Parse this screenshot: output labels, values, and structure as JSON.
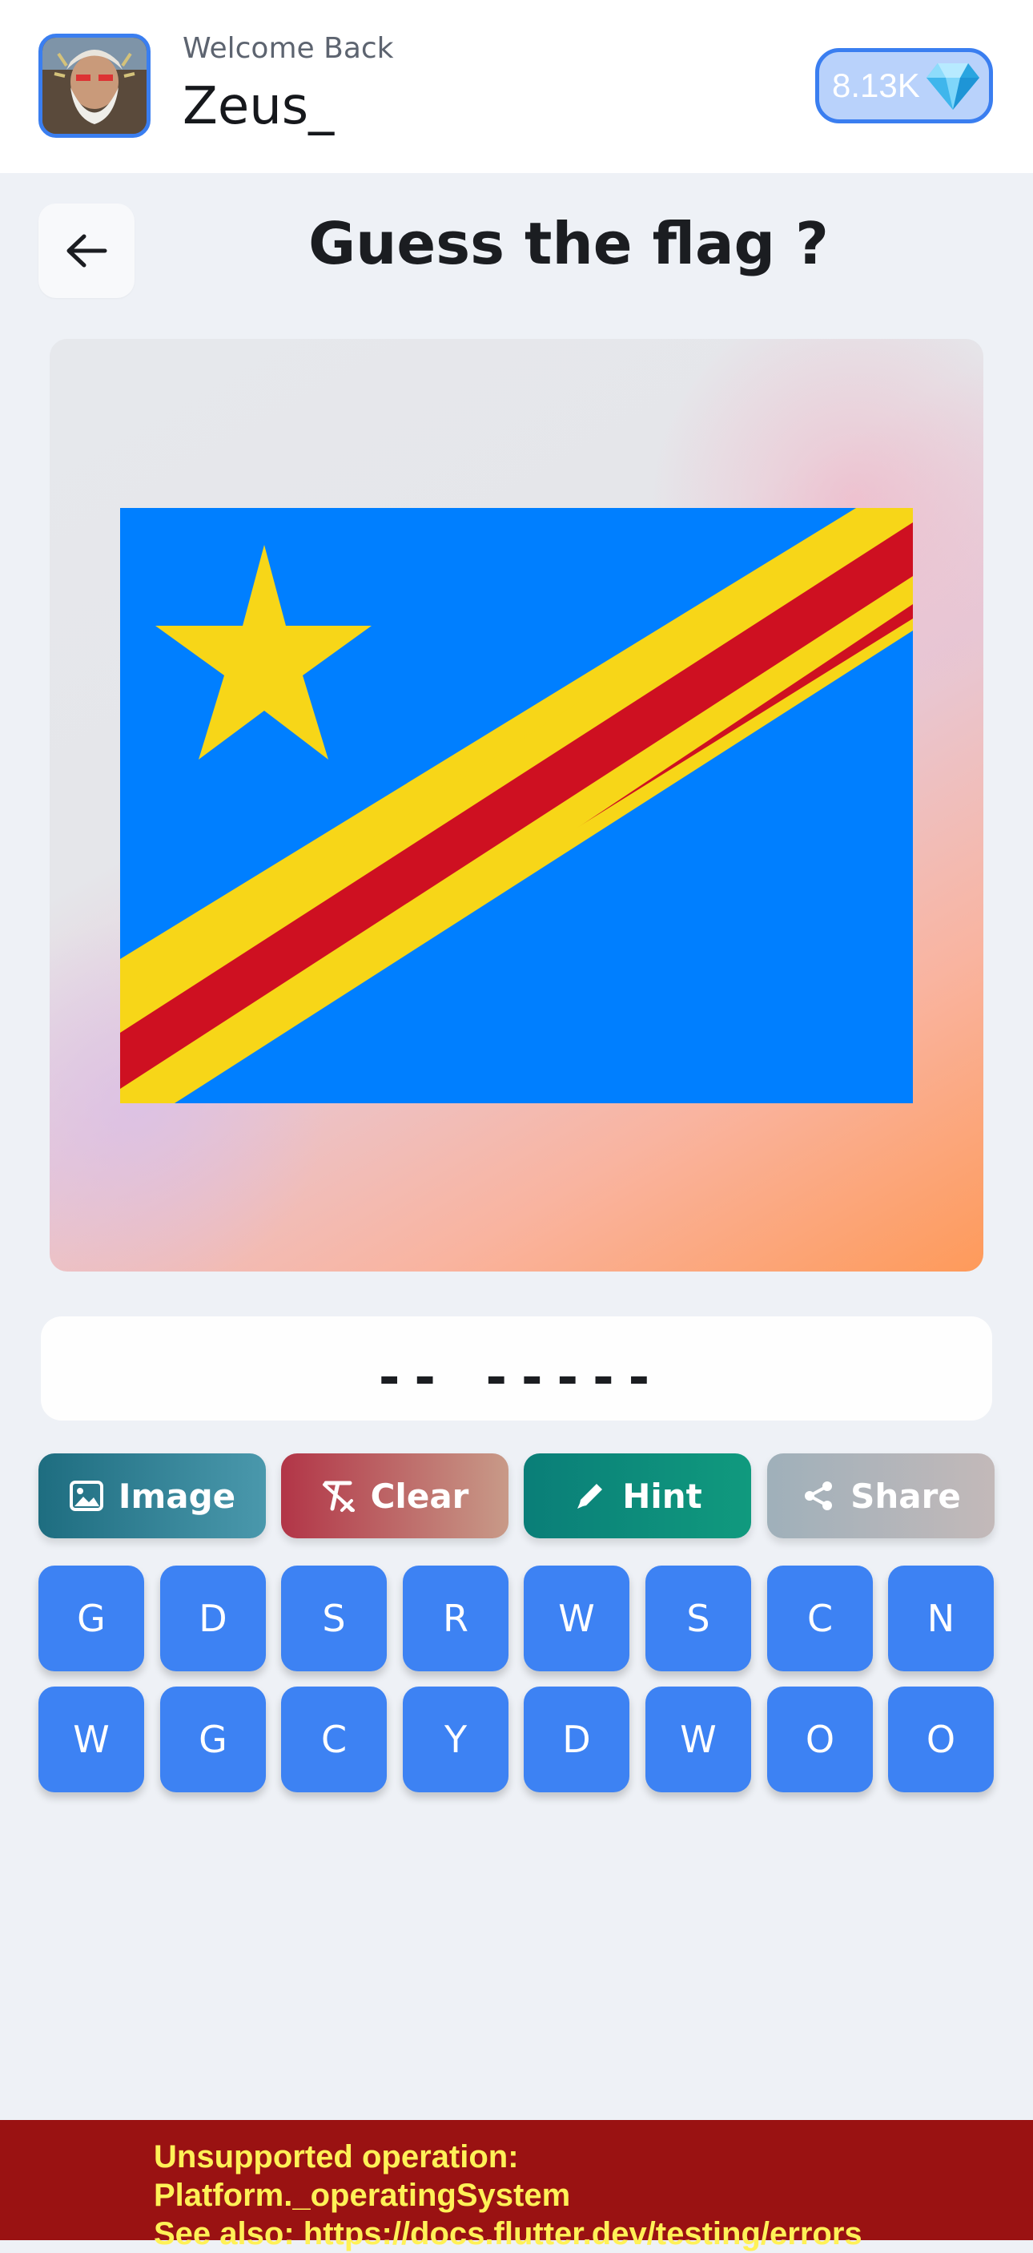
{
  "header": {
    "welcome": "Welcome Back",
    "username": "Zeus_",
    "gems": "8.13K"
  },
  "game": {
    "title": "Guess the flag ?",
    "answer_mask": "-- -----"
  },
  "actions": [
    {
      "label": "Image",
      "icon": "image-icon"
    },
    {
      "label": "Clear",
      "icon": "clear-format-icon"
    },
    {
      "label": "Hint",
      "icon": "pencil-icon"
    },
    {
      "label": "Share",
      "icon": "share-icon"
    }
  ],
  "letters": [
    "G",
    "D",
    "S",
    "R",
    "W",
    "S",
    "C",
    "N",
    "W",
    "G",
    "C",
    "Y",
    "D",
    "W",
    "O",
    "O"
  ],
  "error": {
    "line1": "Unsupported operation:",
    "line2": "Platform._operatingSystem",
    "line3": "See also: https://docs.flutter.dev/testing/errors"
  },
  "colors": {
    "accent": "#3d82f3",
    "flag_blue": "#007fff",
    "flag_red": "#ce1021",
    "flag_yellow": "#f7d618",
    "error_bg": "#9a1212",
    "error_text": "#fff157"
  }
}
